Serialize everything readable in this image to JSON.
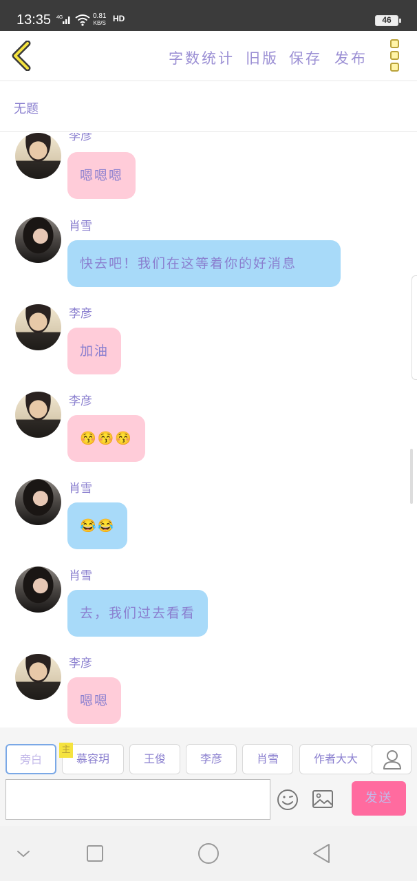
{
  "status_bar": {
    "time": "13:35",
    "network": "4G",
    "speed_value": "0.81",
    "speed_unit": "KB/S",
    "hd": "HD",
    "battery": "46"
  },
  "toolbar": {
    "word_count": "字数统计",
    "old_version": "旧版",
    "save": "保存",
    "publish": "发布"
  },
  "document": {
    "title": "无题"
  },
  "messages": [
    {
      "sender": "李彦",
      "text": "嗯嗯嗯",
      "side": "boy",
      "color": "pink"
    },
    {
      "sender": "肖雪",
      "text": "快去吧！我们在这等着你的好消息",
      "side": "girl",
      "color": "blue"
    },
    {
      "sender": "李彦",
      "text": "加油",
      "side": "boy",
      "color": "pink"
    },
    {
      "sender": "李彦",
      "text": "😚😚😚",
      "side": "boy",
      "color": "pink"
    },
    {
      "sender": "肖雪",
      "text": "😂😂",
      "side": "girl",
      "color": "blue"
    },
    {
      "sender": "肖雪",
      "text": "去，我们过去看看",
      "side": "girl",
      "color": "blue"
    },
    {
      "sender": "李彦",
      "text": "嗯嗯",
      "side": "boy",
      "color": "pink"
    }
  ],
  "roles": {
    "items": [
      "旁白",
      "慕容玥",
      "王俊",
      "李彦",
      "肖雪",
      "作者大大"
    ],
    "main_badge": "主"
  },
  "composer": {
    "input_value": "",
    "send": "发送"
  },
  "colors": {
    "accent_text": "#8a7fcf",
    "pink_bubble": "#ffccd9",
    "blue_bubble": "#a8daf9",
    "send_button": "#ff6b9f"
  },
  "icons": {
    "back": "chevron-left-icon",
    "more": "more-vertical-icon",
    "user": "user-icon",
    "emoji": "smiley-icon",
    "image": "image-icon",
    "nav_down": "chevron-down-icon",
    "nav_recents": "square-icon",
    "nav_home": "circle-icon",
    "nav_back": "triangle-back-icon"
  }
}
